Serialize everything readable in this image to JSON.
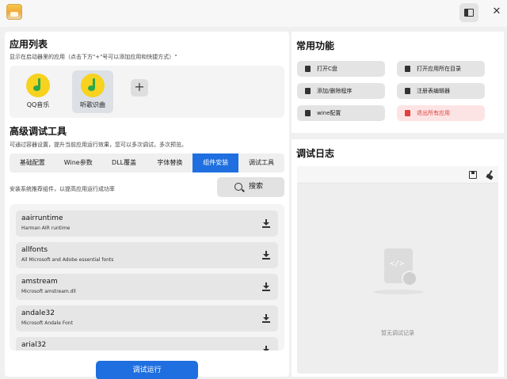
{
  "titlebar": {
    "app_icon": "app-logo-icon",
    "toggle_icon": "sidebar-toggle-icon",
    "close_glyph": "✕"
  },
  "app_list": {
    "title": "应用列表",
    "subtitle": "显示在启动器里的应用（点击下方\"+\"号可以添加应用和快捷方式）\"",
    "apps": [
      {
        "name": "QQ音乐",
        "icon": "music-note-icon",
        "selected": false
      },
      {
        "name": "听歌识曲",
        "icon": "music-note-icon",
        "selected": true
      }
    ],
    "add_glyph": "+"
  },
  "debug_tools": {
    "title": "高级调试工具",
    "subtitle": "可通过容器设置，提升当前应用运行效果，您可以多次调试，多次预览。",
    "tabs": [
      {
        "label": "基础配置",
        "active": false
      },
      {
        "label": "Wine参数",
        "active": false
      },
      {
        "label": "DLL覆盖",
        "active": false
      },
      {
        "label": "字体替换",
        "active": false
      },
      {
        "label": "组件安装",
        "active": true
      },
      {
        "label": "调试工具",
        "active": false
      }
    ],
    "component_hint": "安装系统推荐组件，以提高应用运行成功率",
    "search_label": "搜索",
    "components": [
      {
        "name": "aairruntime",
        "desc": "Harman AIR runtime"
      },
      {
        "name": "allfonts",
        "desc": "All Microsoft and Adobe essential fonts"
      },
      {
        "name": "amstream",
        "desc": "Microsoft amstream.dll"
      },
      {
        "name": "andale32",
        "desc": "Microsoft Andale Font"
      },
      {
        "name": "arial32",
        "desc": ""
      }
    ],
    "run_button": "调试运行"
  },
  "common_functions": {
    "title": "常用功能",
    "buttons": [
      {
        "label": "打开C盘",
        "icon": "drive-icon",
        "danger": false
      },
      {
        "label": "打开应用所在目录",
        "icon": "folder-icon",
        "danger": false
      },
      {
        "label": "添加/删除程序",
        "icon": "package-icon",
        "danger": false
      },
      {
        "label": "注册表编辑器",
        "icon": "registry-icon",
        "danger": false
      },
      {
        "label": "wine配置",
        "icon": "wine-config-icon",
        "danger": false
      },
      {
        "label": "退出所有应用",
        "icon": "exit-icon",
        "danger": true
      }
    ]
  },
  "debug_log": {
    "title": "调试日志",
    "empty_text": "暂无调试记录",
    "code_glyph": "</>"
  },
  "colors": {
    "accent": "#1f6fe0",
    "danger": "#e04040",
    "danger_bg": "#fde4e4"
  }
}
